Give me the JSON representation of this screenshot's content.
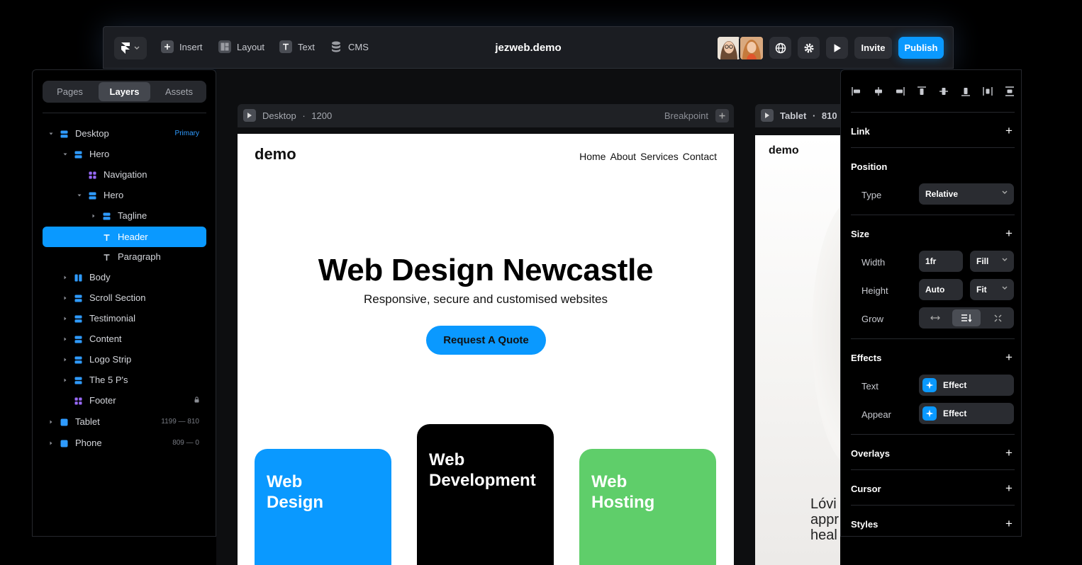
{
  "toolbar": {
    "project_title": "jezweb.demo",
    "insert_label": "Insert",
    "layout_label": "Layout",
    "text_label": "Text",
    "cms_label": "CMS",
    "invite_label": "Invite",
    "publish_label": "Publish"
  },
  "left_panel": {
    "tabs": [
      {
        "label": "Pages"
      },
      {
        "label": "Layers"
      },
      {
        "label": "Assets"
      }
    ],
    "active_tab": "Layers",
    "layers": [
      {
        "name": "Desktop",
        "badge": "Primary"
      },
      {
        "name": "Hero"
      },
      {
        "name": "Navigation"
      },
      {
        "name": "Hero"
      },
      {
        "name": "Tagline"
      },
      {
        "name": "Header"
      },
      {
        "name": "Paragraph"
      },
      {
        "name": "Body"
      },
      {
        "name": "Scroll Section"
      },
      {
        "name": "Testimonial"
      },
      {
        "name": "Content"
      },
      {
        "name": "Logo Strip"
      },
      {
        "name": "The 5 P's"
      },
      {
        "name": "Footer"
      },
      {
        "name": "Tablet",
        "meta": "1199 — 810"
      },
      {
        "name": "Phone",
        "meta": "809 — 0"
      }
    ]
  },
  "desktop_frame": {
    "label": "Desktop",
    "separator": "·",
    "width": "1200",
    "breakpoint_label": "Breakpoint",
    "site": {
      "logo": "demo",
      "nav": [
        "Home",
        "About",
        "Services",
        "Contact"
      ],
      "hero_title": "Web Design Newcastle",
      "hero_subtitle": "Responsive, secure and customised websites",
      "cta_label": "Request A Quote",
      "cards": [
        {
          "line1": "Web",
          "line2": "Design",
          "color": "#0a99ff"
        },
        {
          "line1": "Web",
          "line2": "Development",
          "color": "#000000"
        },
        {
          "line1": "Web",
          "line2": "Hosting",
          "color": "#5fce6a"
        }
      ]
    }
  },
  "tablet_frame": {
    "label": "Tablet",
    "separator": "·",
    "width": "810",
    "site": {
      "logo": "demo",
      "text_lines": [
        "Lóvi",
        "appr",
        "heal"
      ]
    }
  },
  "right_panel": {
    "sections": {
      "link": "Link",
      "position": "Position",
      "size": "Size",
      "effects": "Effects",
      "overlays": "Overlays",
      "cursor": "Cursor",
      "styles": "Styles"
    },
    "position": {
      "type_label": "Type",
      "type_value": "Relative"
    },
    "size": {
      "width_label": "Width",
      "width_value": "1fr",
      "width_mode": "Fill",
      "height_label": "Height",
      "height_value": "Auto",
      "height_mode": "Fit",
      "grow_label": "Grow"
    },
    "effects": {
      "text_label": "Text",
      "text_value": "Effect",
      "appear_label": "Appear",
      "appear_value": "Effect"
    }
  },
  "colors": {
    "accent": "#0a99ff",
    "panel_bg": "#000000",
    "field_bg": "#2a2c31",
    "card_green": "#5fce6a"
  }
}
